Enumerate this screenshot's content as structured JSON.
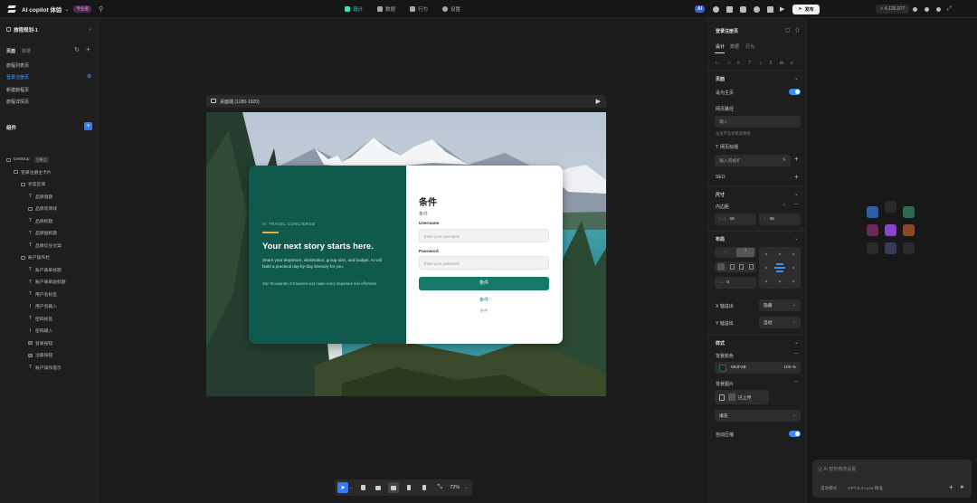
{
  "app": {
    "project_name": "AI copilot 体验",
    "plan_badge": "专业版",
    "credits": "4,126,077",
    "ai_badge": "AI",
    "publish_label": "发布"
  },
  "top_tabs": [
    {
      "label": "设计",
      "active": true
    },
    {
      "label": "数据",
      "active": false
    },
    {
      "label": "行为",
      "active": false
    },
    {
      "label": "设置",
      "active": false
    }
  ],
  "left_panel": {
    "project_title": "旅程规划-1",
    "section_tabs": [
      "页面",
      "数据"
    ],
    "pages": [
      {
        "label": "旅程列表页",
        "active": false
      },
      {
        "label": "登录注册页",
        "active": true
      },
      {
        "label": "新建旅程页",
        "active": false
      },
      {
        "label": "旅程详情页",
        "active": false
      }
    ],
    "components_title": "组件",
    "tree": [
      {
        "label": "Desktop",
        "badge": "主断点",
        "level": 0,
        "icon": "frame"
      },
      {
        "label": "登录注册主卡片",
        "level": 1,
        "icon": "frame"
      },
      {
        "label": "状态区域",
        "level": 2,
        "icon": "frame"
      },
      {
        "label": "品牌眉题",
        "level": 3,
        "icon": "text"
      },
      {
        "label": "品牌装饰线",
        "level": 3,
        "icon": "frame"
      },
      {
        "label": "品牌标题",
        "level": 3,
        "icon": "text"
      },
      {
        "label": "品牌副标题",
        "level": 3,
        "icon": "text"
      },
      {
        "label": "品牌信任文案",
        "level": 3,
        "icon": "text"
      },
      {
        "label": "账户操作栏",
        "level": 2,
        "icon": "frame"
      },
      {
        "label": "账户表单标题",
        "level": 3,
        "icon": "text"
      },
      {
        "label": "账户表单副标题",
        "level": 3,
        "icon": "text"
      },
      {
        "label": "用户名标签",
        "level": 3,
        "icon": "text"
      },
      {
        "label": "用户名输入",
        "level": 3,
        "icon": "input"
      },
      {
        "label": "密码标签",
        "level": 3,
        "icon": "text"
      },
      {
        "label": "密码输入",
        "level": 3,
        "icon": "input"
      },
      {
        "label": "登录按钮",
        "level": 3,
        "icon": "button"
      },
      {
        "label": "注册按钮",
        "level": 3,
        "icon": "button"
      },
      {
        "label": "账户操作提示",
        "level": 3,
        "icon": "text"
      }
    ]
  },
  "canvas": {
    "frame_label": "桌面端 (1280-1920)",
    "zoom": "72%",
    "card": {
      "eyebrow": "AI TRAVEL CONCIERGE",
      "headline": "Your next story starts here.",
      "subtitle": "Share your departure, destination, group size, and budget. AI will build a practical day-by-day itinerary for you.",
      "trust": "Join thousands of travelers and make every departure feel effortless.",
      "form_title": "条件",
      "form_subtitle": "条件",
      "username_label": "Username",
      "username_placeholder": "Enter your username",
      "password_label": "Password",
      "password_placeholder": "Enter your password",
      "primary_button": "条件",
      "secondary_link": "条件",
      "hint": "条件"
    },
    "colors": {
      "card_green": "#0f5a4c",
      "button_green": "#147a67"
    }
  },
  "right_panel": {
    "title": "登录注册页",
    "tabs": [
      {
        "label": "设计",
        "active": true
      },
      {
        "label": "数据",
        "active": false
      },
      {
        "label": "行为",
        "active": false
      }
    ],
    "page_section": "页面",
    "set_home_label": "设为主页",
    "path_label": "网页路径",
    "path_placeholder": "输入",
    "path_hint": "主页不允许修改路径",
    "web_title_label": "网页标题",
    "web_title_placeholder": "输入或被扩",
    "seo_label": "SEO",
    "size_section": "尺寸",
    "padding_label": "内边距",
    "padding_h": "48",
    "padding_v": "48",
    "layout_section": "布局",
    "gap_value": "0",
    "x_overflow_label": "X 轴溢出",
    "x_overflow_value": "隐藏",
    "y_overflow_label": "Y 轴溢出",
    "y_overflow_value": "自动",
    "style_section": "样式",
    "bg_color_label": "背景颜色",
    "bg_color_hex": "082F2B",
    "bg_color_swatch": "#082f2b",
    "bg_opacity": "100 %",
    "bg_image_label": "背景图片",
    "bg_image_value": "已上传",
    "fill_mode": "填充",
    "auto_compress_label": "自动压缩"
  },
  "chat": {
    "placeholder": "让 Ai 帮你修改设置",
    "mode": "自动模式",
    "model": "GPT-5.4 Luna 精准"
  }
}
